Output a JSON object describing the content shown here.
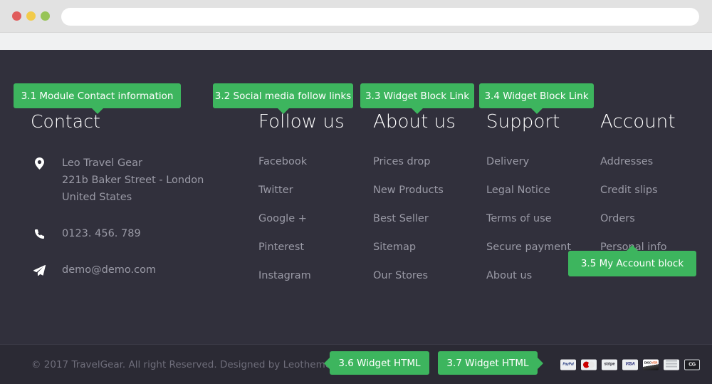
{
  "browser": {
    "traffic_lights": [
      "close",
      "minimize",
      "maximize"
    ],
    "address_value": "",
    "address_placeholder": ""
  },
  "colors": {
    "background": "#31303c",
    "bottom_bar": "#2b2a34",
    "badge_green": "#3db55e",
    "heading": "#ffffff",
    "link": "#9a9aa6",
    "copyright": "#6e6d7a"
  },
  "annotations": [
    {
      "id": "badge-31",
      "label": "3.1 Module Contact information",
      "tail": "down"
    },
    {
      "id": "badge-32",
      "label": "3.2 Social media follow links",
      "tail": "down"
    },
    {
      "id": "badge-33",
      "label": "3.3 Widget Block Link",
      "tail": "down"
    },
    {
      "id": "badge-34",
      "label": "3.4 Widget Block Link",
      "tail": "down"
    },
    {
      "id": "badge-35",
      "label": "3.5 My Account block",
      "tail": "up"
    },
    {
      "id": "badge-36",
      "label": "3.6 Widget HTML",
      "tail": "left"
    },
    {
      "id": "badge-37",
      "label": "3.7 Widget HTML",
      "tail": "right"
    }
  ],
  "footer": {
    "columns": {
      "contact": {
        "title": "Contact",
        "items": [
          {
            "icon": "map-marker-icon",
            "lines": [
              "Leo Travel Gear",
              "221b Baker Street - London",
              "United States"
            ]
          },
          {
            "icon": "phone-icon",
            "lines": [
              "0123. 456. 789"
            ]
          },
          {
            "icon": "paper-plane-icon",
            "lines": [
              "demo@demo.com"
            ]
          }
        ]
      },
      "follow": {
        "title": "Follow us",
        "links": [
          "Facebook",
          "Twitter",
          "Google +",
          "Pinterest",
          "Instagram"
        ]
      },
      "about": {
        "title": "About us",
        "links": [
          "Prices drop",
          "New Products",
          "Best Seller",
          "Sitemap",
          "Our Stores"
        ]
      },
      "support": {
        "title": "Support",
        "links": [
          "Delivery",
          "Legal Notice",
          "Terms of use",
          "Secure payment",
          "About us"
        ]
      },
      "account": {
        "title": "Account",
        "links": [
          "Addresses",
          "Credit slips",
          "Orders",
          "Personal info"
        ]
      }
    },
    "copyright": "© 2017 TravelGear. All right Reserved. Designed by Leotheme",
    "payment_methods": [
      "PayPal",
      "Mastercard",
      "stripe",
      "VISA",
      "Discover",
      "Card",
      "CG"
    ]
  }
}
